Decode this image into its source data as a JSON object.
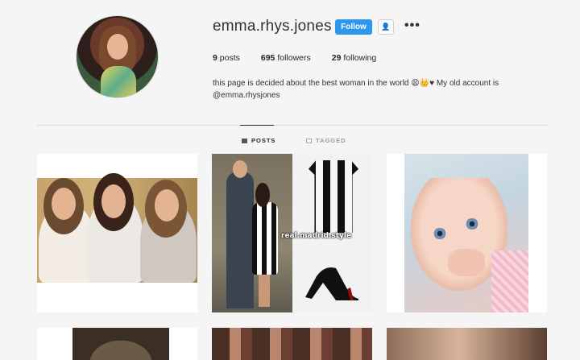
{
  "profile": {
    "username": "emma.rhys.jones",
    "follow_label": "Follow",
    "more_label": "•••",
    "suggest_icon": "person-plus-icon",
    "stats": [
      {
        "count": "9",
        "label": "posts"
      },
      {
        "count": "695",
        "label": "followers"
      },
      {
        "count": "29",
        "label": "following"
      }
    ],
    "bio_line1": "this page is decided about the best woman in the world 😩👑♥ My old account is",
    "bio_line2": "@emma.rhysjones"
  },
  "tabs": [
    {
      "label": "POSTS",
      "icon": "grid-icon",
      "active": true
    },
    {
      "label": "TAGGED",
      "icon": "tag-icon",
      "active": false
    }
  ],
  "posts": {
    "p2_watermark": "real.madrid.style"
  },
  "colors": {
    "accent": "#2d97f0",
    "background": "#f5f5f5"
  }
}
